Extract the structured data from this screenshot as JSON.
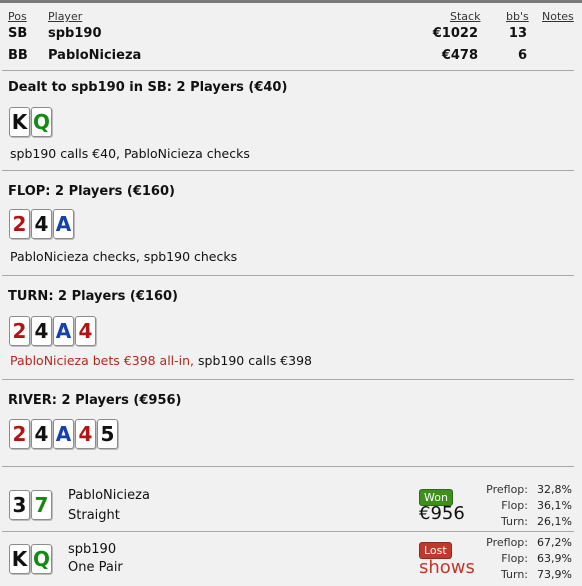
{
  "header": {
    "pos": "Pos",
    "player": "Player",
    "stack": "Stack",
    "bbs": "bb's",
    "notes": "Notes"
  },
  "players": [
    {
      "pos": "SB",
      "name": "spb190",
      "stack": "€1022",
      "bbs": "13"
    },
    {
      "pos": "BB",
      "name": "PabloNicieza",
      "stack": "€478",
      "bbs": "6"
    }
  ],
  "streets": {
    "preflop": {
      "title": "Dealt to spb190 in SB: 2 Players (€40)",
      "cards": [
        {
          "rank": "K",
          "suit": "s"
        },
        {
          "rank": "Q",
          "suit": "c"
        }
      ],
      "action": "spb190 calls €40, PabloNicieza checks"
    },
    "flop": {
      "title": "FLOP: 2 Players (€160)",
      "cards": [
        {
          "rank": "2",
          "suit": "h"
        },
        {
          "rank": "4",
          "suit": "s"
        },
        {
          "rank": "A",
          "suit": "d"
        }
      ],
      "action": "PabloNicieza checks, spb190 checks"
    },
    "turn": {
      "title": "TURN: 2 Players (€160)",
      "cards": [
        {
          "rank": "2",
          "suit": "h"
        },
        {
          "rank": "4",
          "suit": "s"
        },
        {
          "rank": "A",
          "suit": "d"
        },
        {
          "rank": "4",
          "suit": "h"
        }
      ],
      "action_highlight": "PabloNicieza bets €398 all-in,",
      "action_rest": " spb190 calls €398"
    },
    "river": {
      "title": "RIVER: 2 Players (€956)",
      "cards": [
        {
          "rank": "2",
          "suit": "h"
        },
        {
          "rank": "4",
          "suit": "s"
        },
        {
          "rank": "A",
          "suit": "d"
        },
        {
          "rank": "4",
          "suit": "h"
        },
        {
          "rank": "5",
          "suit": "s"
        }
      ]
    }
  },
  "results": [
    {
      "name": "PabloNicieza",
      "hand": "Straight",
      "cards": [
        {
          "rank": "3",
          "suit": "s"
        },
        {
          "rank": "7",
          "suit": "c"
        }
      ],
      "badge": "Won",
      "badge_color": "#3f8f1f",
      "amount": "€956",
      "amount_color": "#111111",
      "stats": [
        {
          "label": "Preflop:",
          "value": "32,8%"
        },
        {
          "label": "Flop:",
          "value": "36,1%"
        },
        {
          "label": "Turn:",
          "value": "26,1%"
        }
      ]
    },
    {
      "name": "spb190",
      "hand": "One Pair",
      "cards": [
        {
          "rank": "K",
          "suit": "s"
        },
        {
          "rank": "Q",
          "suit": "c"
        }
      ],
      "badge": "Lost",
      "badge_color": "#c0392b",
      "amount": "shows",
      "amount_color": "#c0392b",
      "stats": [
        {
          "label": "Preflop:",
          "value": "67,2%"
        },
        {
          "label": "Flop:",
          "value": "63,9%"
        },
        {
          "label": "Turn:",
          "value": "73,9%"
        }
      ]
    }
  ],
  "colors": {
    "spades": "#111111",
    "hearts": "#b01414",
    "diamonds": "#1540b0",
    "clubs": "#138a13"
  }
}
